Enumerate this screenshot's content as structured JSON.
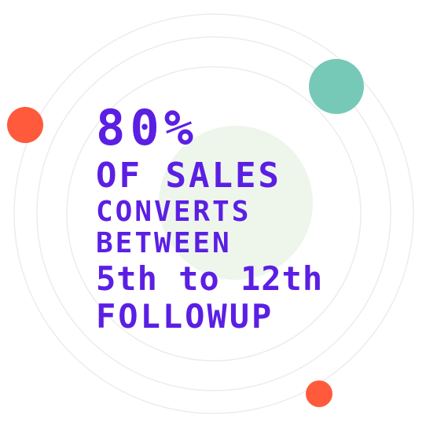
{
  "colors": {
    "text": "#5b1fe4",
    "orange_dot": "#ff5a3c",
    "teal_dot": "#76c9b7",
    "green_blob": "#eef6ec",
    "ring": "#ececec"
  },
  "stat": {
    "percent": "80%",
    "line2": "OF SALES",
    "line3": "CONVERTS",
    "line4": "BETWEEN",
    "line5": "5th to 12th",
    "line6": "FOLLOWUP"
  }
}
